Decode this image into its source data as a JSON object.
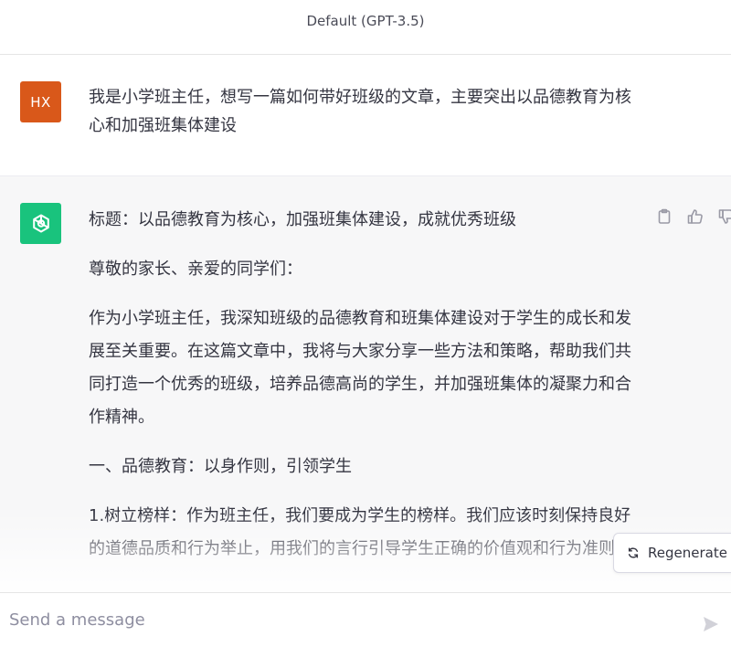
{
  "header": {
    "model_label": "Default (GPT-3.5)"
  },
  "user_message": {
    "avatar_initials": "HX",
    "avatar_color": "#d9581a",
    "text": "我是小学班主任，想写一篇如何带好班级的文章，主要突出以品德教育为核心和加强班集体建设"
  },
  "assistant_message": {
    "avatar_color": "#19c37d",
    "avatar_icon": "openai-logo-icon",
    "paragraphs": [
      "标题：以品德教育为核心，加强班集体建设，成就优秀班级",
      "尊敬的家长、亲爱的同学们：",
      "作为小学班主任，我深知班级的品德教育和班集体建设对于学生的成长和发展至关重要。在这篇文章中，我将与大家分享一些方法和策略，帮助我们共同打造一个优秀的班级，培养品德高尚的学生，并加强班集体的凝聚力和合作精神。",
      "一、品德教育：以身作则，引领学生",
      "1.树立榜样：作为班主任，我们要成为学生的榜样。我们应该时刻保持良好的道德品质和行为举止，用我们的言行引导学生正确的价值观和行为准则。"
    ],
    "actions": [
      "copy-icon",
      "thumbs-up-icon",
      "thumbs-down-icon"
    ]
  },
  "regenerate": {
    "label": "Regenerate",
    "icon": "refresh-icon"
  },
  "composer": {
    "placeholder": "Send a message",
    "send_icon": "send-icon"
  }
}
